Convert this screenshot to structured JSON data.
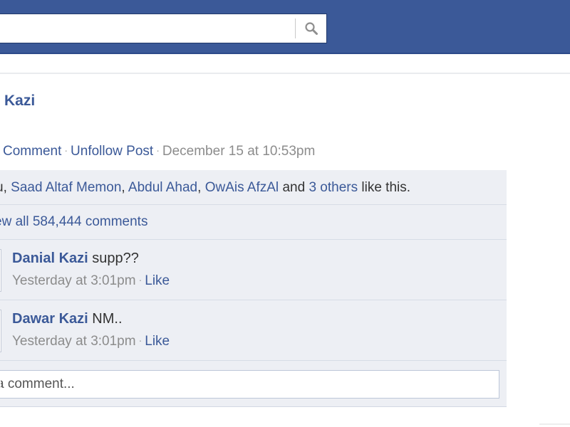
{
  "search": {
    "value": "",
    "placeholder": ""
  },
  "post": {
    "author": "Kazi",
    "actions": {
      "comment": "Comment",
      "unfollow": "Unfollow Post",
      "timestamp": "December 15 at 10:53pm"
    }
  },
  "likes": {
    "prefix": "u,",
    "names": [
      "Saad Altaf Memon",
      "Abdul Ahad",
      "OwAis AfzAl"
    ],
    "and": "and",
    "others": "3 others",
    "suffix": "like this."
  },
  "view_all": "ew all 584,444 comments",
  "comments": [
    {
      "author": "Danial Kazi",
      "text": "supp??",
      "time": "Yesterday at 3:01pm",
      "like": "Like"
    },
    {
      "author": "Dawar Kazi",
      "text": "NM..",
      "time": "Yesterday at 3:01pm",
      "like": "Like"
    }
  ],
  "write_comment": {
    "placeholder": "a comment..."
  },
  "colors": {
    "brand": "#3b5998",
    "ufi_bg": "#edeff4"
  },
  "icons": {
    "search": "magnifying-glass"
  }
}
